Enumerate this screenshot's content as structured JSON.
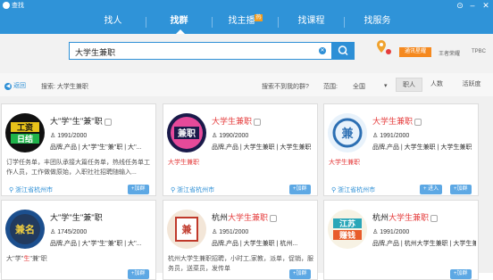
{
  "window": {
    "title": "查找"
  },
  "nav": {
    "tabs": [
      {
        "label": "找人"
      },
      {
        "label": "找群"
      },
      {
        "label": "找主播",
        "badge": "热"
      },
      {
        "label": "找课程"
      },
      {
        "label": "找服务"
      }
    ]
  },
  "search": {
    "value": "大学生兼职"
  },
  "top_right": {
    "vip": "通讯星耀",
    "link1": "王者荣耀",
    "link2": "TPBC"
  },
  "filterbar": {
    "back": "返回",
    "crumb": "搜索: 大学生兼职",
    "help": "搜索不到我的群?",
    "range": "范围:",
    "scope": "全国",
    "tabs": [
      "职人",
      "人数",
      "活跃度"
    ]
  },
  "cards": [
    {
      "title_plain": "大''学''生''兼''职",
      "count": "1991/2000",
      "tags": "品牌,产品 | 大''学''生''兼''职 | 大''...",
      "desc": "订学任务单，丰团队承接大篇任务单，热线任务单工作人员，工作做做原始，入职社社招聘随输入...",
      "location": "浙江省杭州市",
      "join": "+加群"
    },
    {
      "title_hl": "大学生兼职",
      "count": "1990/2000",
      "tags": "品牌,产品 | 大学生兼职 | 大学生兼职",
      "desc": "大学生兼职",
      "location": "浙江省杭州市",
      "join": "+加群"
    },
    {
      "title_hl": "大学生兼职",
      "count": "1991/2000",
      "tags": "品牌,产品 | 大学生兼职 | 大学生兼职",
      "desc": "大学生兼职",
      "location": "浙江省杭州市",
      "join2": "+ 进入",
      "join": "+加群"
    },
    {
      "title_plain": "大''学''生''兼''职",
      "count": "1745/2000",
      "tags": "品牌,产品 | 大''学''生''兼''职 | 大''...",
      "desc_pre": "大''学''",
      "desc_hl": "生",
      "desc_post": "''兼''职",
      "join": "+加群"
    },
    {
      "title_plain": "杭州",
      "title_hl": "大学生兼职",
      "count": "1951/2000",
      "tags": "品牌,产品 | 大学生兼职 | 杭州...",
      "desc": "杭州大学生兼职招聘，小时工,家教，派单，促销，服务员，送菜员，发传单",
      "join": "+加群"
    },
    {
      "title_plain": "杭州",
      "title_hl": "大学生兼职",
      "count": "1991/2000",
      "tags": "品牌,产品 | 杭州大学生兼职 | 大学生兼职",
      "desc": "",
      "join": "+加群"
    }
  ]
}
